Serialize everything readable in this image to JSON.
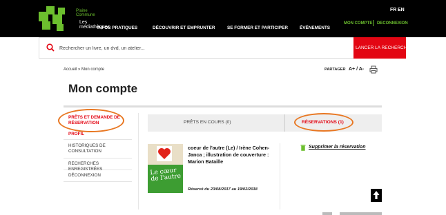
{
  "header": {
    "brand_small_line1": "Plaine",
    "brand_small_line2": "Commune",
    "brand_name_line1": "Les",
    "brand_name_line2": "médiathèques",
    "nav": [
      "INFOS PRATIQUES",
      "DÉCOUVRIR ET EMPRUNTER",
      "SE FORMER ET PARTICIPER",
      "ÉVÉNEMENTS"
    ],
    "lang": [
      "FR",
      "EN"
    ],
    "account": "MON COMPTE",
    "logout": "DECONNEXION",
    "colors": {
      "background": "#000000",
      "accent": "#6cbf2e"
    }
  },
  "search": {
    "placeholder": "Rechercher un livre, un dvd, un atelier...",
    "value": "",
    "button": "LANCER LA RECHERCHE",
    "icon": "search-icon",
    "button_color": "#e30613"
  },
  "toolbar": {
    "breadcrumb": "Accueil » Mon compte",
    "share": "PARTAGER",
    "font_size": "A+ / A-",
    "print_icon": "printer-icon"
  },
  "page": {
    "title": "Mon compte"
  },
  "sidebar": {
    "items": [
      {
        "label": "PRÊTS ET DEMANDE DE RÉSERVATION",
        "active": true
      },
      {
        "label": "PROFIL"
      },
      {
        "label": "HISTORIQUES DE CONSULTATION"
      },
      {
        "label": "RECHERCHES ENREGISTRÉES"
      },
      {
        "label": "DÉCONNEXION"
      }
    ]
  },
  "tabs": [
    {
      "label": "PRÊTS EN COURS (0)"
    },
    {
      "label": "RÉSERVATIONS (1)",
      "active": true
    }
  ],
  "reservation": {
    "cover_title": "Le cœur de l'autre",
    "title": "coeur de l'autre (Le) / Irène Cohen-Janca ; illustration de couverture : Marion Bataille",
    "reserved_dates": "Réservé du 23/08/2017 au 19/02/2018",
    "cancel": "Supprimer la réservation",
    "cancel_icon": "trash-icon"
  },
  "annotation_color": "#e87722"
}
